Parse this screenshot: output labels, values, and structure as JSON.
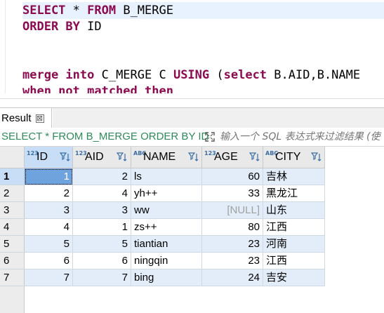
{
  "editor": {
    "line1": {
      "kw1": "SELECT",
      "text1": " * ",
      "kw2": "FROM",
      "text2": " B_MERGE"
    },
    "line2": {
      "kw1": "ORDER BY",
      "text1": " ID"
    },
    "line4": {
      "kw1": "merge into",
      "text1": " C_MERGE C ",
      "kw2": "USING",
      "text2": " (",
      "kw3": "select",
      "text3": " B.AID,B.NAME"
    },
    "line5": {
      "kw1": "when not matched then",
      "text1": ""
    }
  },
  "results": {
    "tab_label": "Result",
    "tab_close": "⊠",
    "query": "SELECT * FROM B_MERGE ORDER BY ID",
    "filter_placeholder": "输入一个 SQL 表达式来过滤结果 (使"
  },
  "grid": {
    "columns": [
      {
        "name": "ID",
        "type_badge": "123"
      },
      {
        "name": "AID",
        "type_badge": "123"
      },
      {
        "name": "NAME",
        "type_badge": "ABC"
      },
      {
        "name": "AGE",
        "type_badge": "123"
      },
      {
        "name": "CITY",
        "type_badge": "ABC"
      }
    ],
    "rows": [
      {
        "rownum": "1",
        "id": "1",
        "aid": "2",
        "name": "ls",
        "age": "60",
        "city": "吉林"
      },
      {
        "rownum": "2",
        "id": "2",
        "aid": "4",
        "name": "yh++",
        "age": "33",
        "city": "黑龙江"
      },
      {
        "rownum": "3",
        "id": "3",
        "aid": "3",
        "name": "ww",
        "age": "[NULL]",
        "city": "山东"
      },
      {
        "rownum": "4",
        "id": "4",
        "aid": "1",
        "name": "zs++",
        "age": "80",
        "city": "江西"
      },
      {
        "rownum": "5",
        "id": "5",
        "aid": "5",
        "name": "tiantian",
        "age": "23",
        "city": "河南"
      },
      {
        "rownum": "6",
        "id": "6",
        "aid": "6",
        "name": "ningqin",
        "age": "23",
        "city": "江西"
      },
      {
        "rownum": "7",
        "id": "7",
        "aid": "7",
        "name": "bing",
        "age": "24",
        "city": "吉安"
      }
    ]
  }
}
